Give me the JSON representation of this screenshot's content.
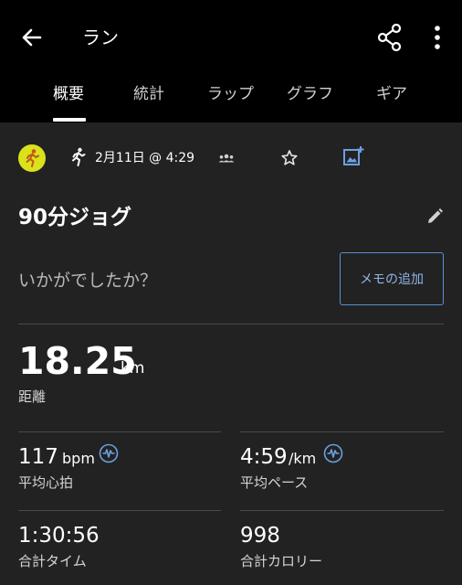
{
  "header": {
    "title": "ラン"
  },
  "tabs": [
    {
      "label": "概要"
    },
    {
      "label": "統計"
    },
    {
      "label": "ラップ"
    },
    {
      "label": "グラフ"
    },
    {
      "label": "ギア"
    }
  ],
  "activity": {
    "date": "2月11日 @ 4:29",
    "name": "90分ジョグ",
    "prompt": "いかがでしたか？",
    "memo_button": "メモの追加"
  },
  "distance": {
    "value": "18.25",
    "unit": "km",
    "label": "距離"
  },
  "stats": [
    {
      "value": "117",
      "unit": "bpm",
      "label": "平均心拍"
    },
    {
      "value": "4:59",
      "unit": "/km",
      "label": "平均ペース"
    },
    {
      "value": "1:30:56",
      "unit": "",
      "label": "合計タイム"
    },
    {
      "value": "998",
      "unit": "",
      "label": "合計カロリー"
    }
  ],
  "colors": {
    "background": "#222222",
    "topbar": "#000000",
    "accent_blue": "#5b8fd3",
    "activity_icon": "#d9e21a"
  }
}
